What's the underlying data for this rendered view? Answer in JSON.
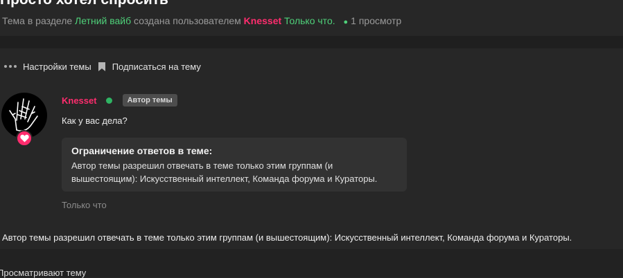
{
  "topic": {
    "title": "Просто хотел спросить",
    "meta_prefix": "Тема в разделе",
    "section": "Летний вайб",
    "meta_created_by": "создана пользователем",
    "author": "Knesset",
    "time": "Только что.",
    "views": "1 просмотр"
  },
  "toolbar": {
    "settings_label": "Настройки темы",
    "subscribe_label": "Подписаться на тему"
  },
  "post": {
    "author": "Knesset",
    "author_badge": "Автор темы",
    "text": "Как у вас дела?",
    "restriction_title": "Ограничение ответов в теме:",
    "restriction_text": "Автор темы разрешил отвечать в теме только этим группам (и вышестоящим): Искусственный интеллект, Команда форума и Кураторы.",
    "time": "Только что"
  },
  "notice": "Автор темы разрешил отвечать в теме только этим группам (и вышестоящим): Искусственный интеллект, Команда форума и Кураторы.",
  "watching_label": "Просматривают тему",
  "colors": {
    "background": "#272727",
    "accent_green": "#4fd17a",
    "accent_pink": "#ff2d6e",
    "online": "#2fb463"
  }
}
